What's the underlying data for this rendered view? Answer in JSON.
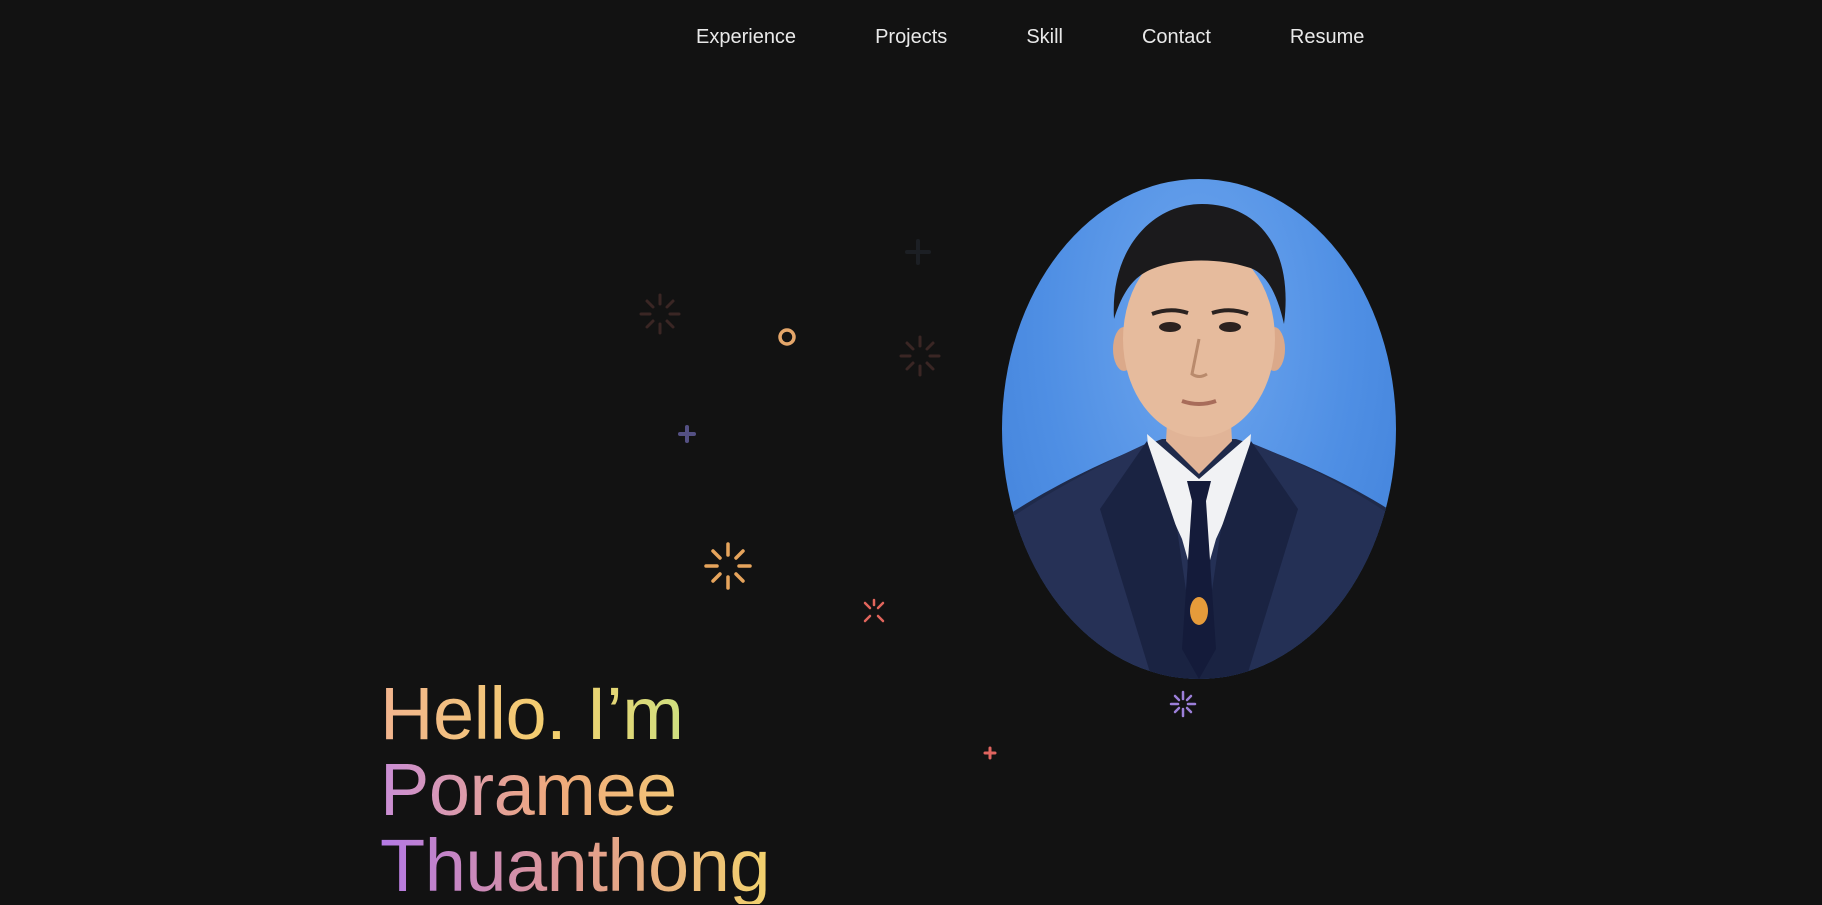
{
  "nav": {
    "items": [
      {
        "label": "Experience"
      },
      {
        "label": "Projects"
      },
      {
        "label": "Skill"
      },
      {
        "label": "Contact"
      },
      {
        "label": "Resume"
      }
    ]
  },
  "hero": {
    "line1": "Hello. I’m",
    "line2": "Poramee",
    "line3": "Thuanthong"
  },
  "colors": {
    "background": "#121212",
    "nav_text": "#e9e9e9",
    "portrait_bg": "#4f8fe4"
  }
}
